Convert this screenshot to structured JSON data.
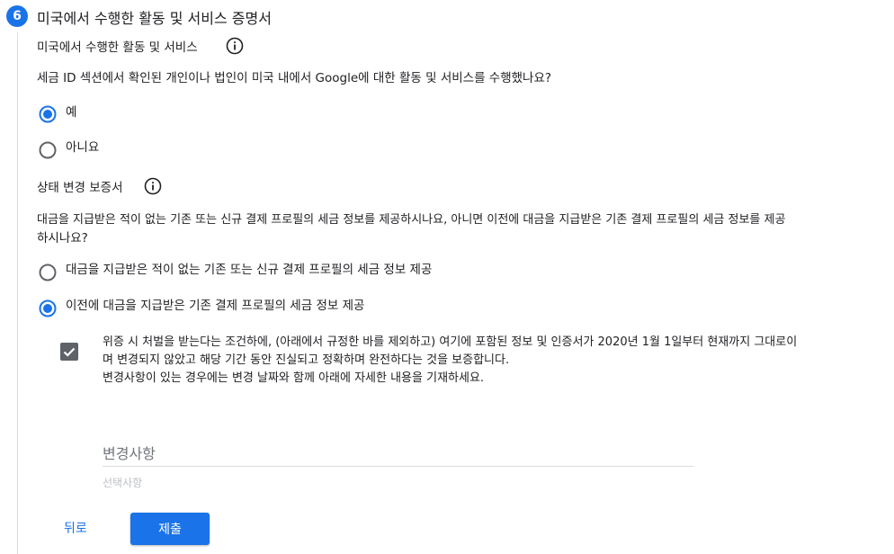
{
  "step": {
    "number": "6",
    "title": "미국에서 수행한 활동 및 서비스 증명서"
  },
  "section1": {
    "label": "미국에서 수행한 활동 및 서비스",
    "question": "세금 ID 섹션에서 확인된 개인이나 법인이 미국 내에서 Google에 대한 활동 및 서비스를 수행했나요?",
    "options": [
      {
        "label": "예",
        "selected": true
      },
      {
        "label": "아니요",
        "selected": false
      }
    ]
  },
  "section2": {
    "label": "상태 변경 보증서",
    "question_line1": "대금을 지급받은 적이 없는 기존 또는 신규 결제 프로필의 세금 정보를 제공하시나요, 아니면 이전에 대금을 지급받은 기존 결제 프로필의 세금 정보를 제공",
    "question_line2": "하시나요?",
    "options": [
      {
        "label": "대금을 지급받은 적이 없는 기존 또는 신규 결제 프로필의 세금 정보 제공",
        "selected": false
      },
      {
        "label": "이전에 대금을 지급받은 기존 결제 프로필의 세금 정보 제공",
        "selected": true
      }
    ]
  },
  "certification": {
    "checked": true,
    "line1": "위증 시 처벌을 받는다는 조건하에, (아래에서 규정한 바를 제외하고) 여기에 포함된 정보 및 인증서가 2020년 1월 1일부터 현재까지 그대로이",
    "line2": "며 변경되지 않았고 해당 기간 동안 진실되고 정확하며 완전하다는 것을 보증합니다.",
    "line3": "변경사항이 있는 경우에는 변경 날짜와 함께 아래에 자세한 내용을 기재하세요."
  },
  "changes_field": {
    "label": "변경사항",
    "hint": "선택사항"
  },
  "actions": {
    "back_label": "뒤로",
    "submit_label": "제출"
  },
  "colors": {
    "accent": "#1a73e8",
    "checkbox": "#5f6368"
  }
}
